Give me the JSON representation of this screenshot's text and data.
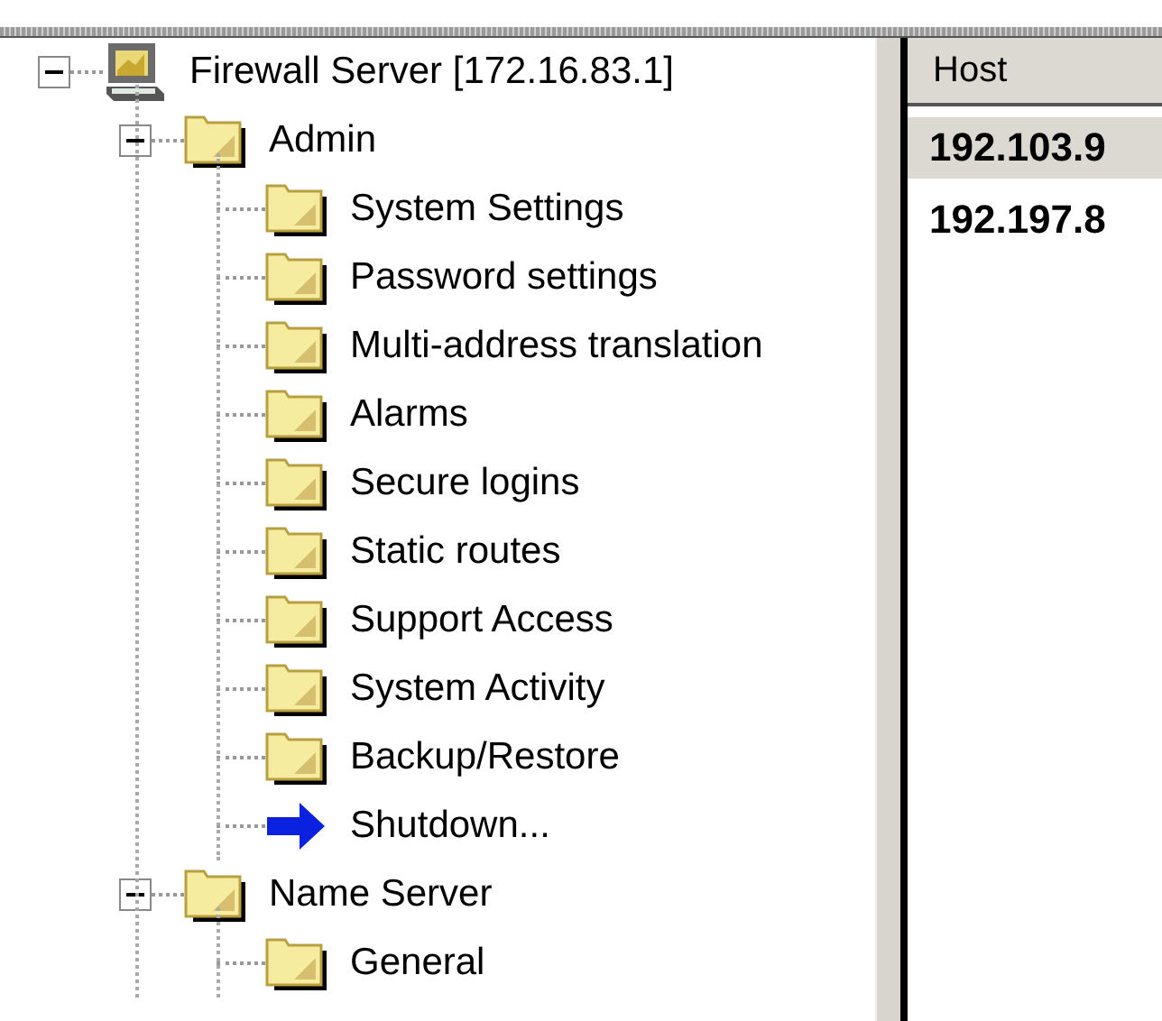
{
  "tree": {
    "label": "Firewall Server [172.16.83.1]",
    "kind": "computer",
    "expanded": true,
    "children": [
      {
        "label": "Admin",
        "kind": "folder",
        "expanded": true,
        "children": [
          {
            "label": "System Settings",
            "kind": "folder"
          },
          {
            "label": "Password settings",
            "kind": "folder"
          },
          {
            "label": "Multi-address translation",
            "kind": "folder"
          },
          {
            "label": "Alarms",
            "kind": "folder"
          },
          {
            "label": "Secure logins",
            "kind": "folder"
          },
          {
            "label": "Static routes",
            "kind": "folder"
          },
          {
            "label": "Support Access",
            "kind": "folder"
          },
          {
            "label": "System Activity",
            "kind": "folder"
          },
          {
            "label": "Backup/Restore",
            "kind": "folder"
          },
          {
            "label": "Shutdown...",
            "kind": "action"
          }
        ]
      },
      {
        "label": "Name Server",
        "kind": "folder",
        "expanded": true,
        "children": [
          {
            "label": "General",
            "kind": "folder"
          }
        ]
      }
    ]
  },
  "host_list": {
    "column": "Host",
    "rows": [
      {
        "host": "192.103.9",
        "selected": true
      },
      {
        "host": "192.197.8",
        "selected": false
      }
    ]
  }
}
